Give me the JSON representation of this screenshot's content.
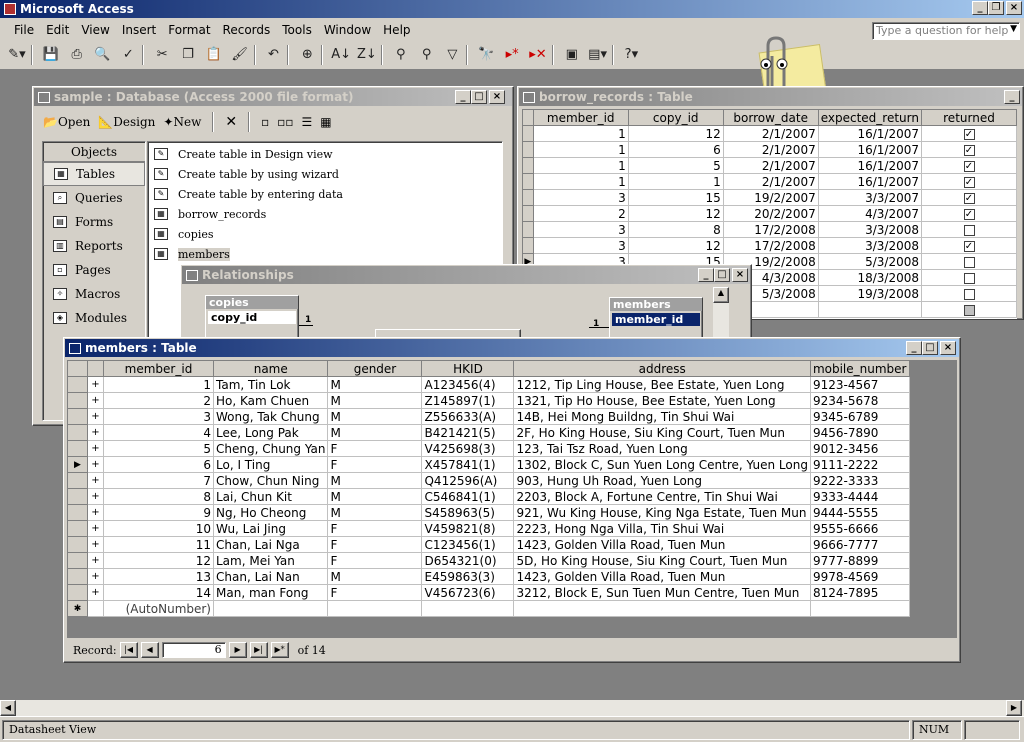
{
  "app": {
    "title": "Microsoft Access",
    "help_placeholder": "Type a question for help"
  },
  "menu": [
    "File",
    "Edit",
    "View",
    "Insert",
    "Format",
    "Records",
    "Tools",
    "Window",
    "Help"
  ],
  "db_window": {
    "title": "sample : Database (Access 2000 file format)",
    "open": "Open",
    "design": "Design",
    "new": "New",
    "objects_header": "Objects",
    "objects": [
      "Tables",
      "Queries",
      "Forms",
      "Reports",
      "Pages",
      "Macros",
      "Modules"
    ],
    "items": [
      "Create table in Design view",
      "Create table by using wizard",
      "Create table by entering data",
      "borrow_records",
      "copies",
      "members"
    ]
  },
  "borrow": {
    "title": "borrow_records : Table",
    "columns": [
      "member_id",
      "copy_id",
      "borrow_date",
      "expected_return",
      "returned"
    ],
    "rows": [
      [
        "1",
        "12",
        "2/1/2007",
        "16/1/2007",
        true
      ],
      [
        "1",
        "6",
        "2/1/2007",
        "16/1/2007",
        true
      ],
      [
        "1",
        "5",
        "2/1/2007",
        "16/1/2007",
        true
      ],
      [
        "1",
        "1",
        "2/1/2007",
        "16/1/2007",
        true
      ],
      [
        "3",
        "15",
        "19/2/2007",
        "3/3/2007",
        true
      ],
      [
        "2",
        "12",
        "20/2/2007",
        "4/3/2007",
        true
      ],
      [
        "3",
        "8",
        "17/2/2008",
        "3/3/2008",
        false
      ],
      [
        "3",
        "12",
        "17/2/2008",
        "3/3/2008",
        true
      ],
      [
        "3",
        "15",
        "19/2/2008",
        "5/3/2008",
        false
      ],
      [
        "",
        "",
        "4/3/2008",
        "18/3/2008",
        false
      ],
      [
        "",
        "",
        "5/3/2008",
        "19/3/2008",
        false
      ]
    ]
  },
  "relationships": {
    "title": "Relationships",
    "copies_title": "copies",
    "copies_field": "copy_id",
    "members_title": "members",
    "members_field": "member_id",
    "one": "1"
  },
  "members": {
    "title": "members : Table",
    "columns": [
      "member_id",
      "name",
      "gender",
      "HKID",
      "address",
      "mobile_number"
    ],
    "rows": [
      [
        "1",
        "Tam, Tin Lok",
        "M",
        "A123456(4)",
        "1212, Tip Ling House, Bee Estate, Yuen Long",
        "9123-4567"
      ],
      [
        "2",
        "Ho, Kam Chuen",
        "M",
        "Z145897(1)",
        "1321, Tip Ho House, Bee Estate, Yuen Long",
        "9234-5678"
      ],
      [
        "3",
        "Wong, Tak Chung",
        "M",
        "Z556633(A)",
        "14B, Hei Mong Buildng, Tin Shui Wai",
        "9345-6789"
      ],
      [
        "4",
        "Lee, Long Pak",
        "M",
        "B421421(5)",
        "2F, Ho King House, Siu King Court, Tuen Mun",
        "9456-7890"
      ],
      [
        "5",
        "Cheng, Chung Yan",
        "F",
        "V425698(3)",
        "123, Tai Tsz Road, Yuen Long",
        "9012-3456"
      ],
      [
        "6",
        "Lo, I Ting",
        "F",
        "X457841(1)",
        "1302, Block C, Sun Yuen Long Centre, Yuen Long",
        "9111-2222"
      ],
      [
        "7",
        "Chow, Chun Ning",
        "M",
        "Q412596(A)",
        "903, Hung Uh Road, Yuen Long",
        "9222-3333"
      ],
      [
        "8",
        "Lai, Chun Kit",
        "M",
        "C546841(1)",
        "2203, Block A, Fortune Centre, Tin Shui Wai",
        "9333-4444"
      ],
      [
        "9",
        "Ng, Ho Cheong",
        "M",
        "S458963(5)",
        "921, Wu King House, King Nga Estate, Tuen Mun",
        "9444-5555"
      ],
      [
        "10",
        "Wu, Lai Jing",
        "F",
        "V459821(8)",
        "2223, Hong Nga Villa, Tin Shui Wai",
        "9555-6666"
      ],
      [
        "11",
        "Chan, Lai Nga",
        "F",
        "C123456(1)",
        "1423, Golden Villa Road, Tuen Mun",
        "9666-7777"
      ],
      [
        "12",
        "Lam, Mei Yan",
        "F",
        "D654321(0)",
        "5D, Ho King House, Siu King Court, Tuen Mun",
        "9777-8899"
      ],
      [
        "13",
        "Chan, Lai Nan",
        "M",
        "E459863(3)",
        "1423, Golden Villa Road, Tuen Mun",
        "9978-4569"
      ],
      [
        "14",
        "Man, man Fong",
        "F",
        "V456723(6)",
        "3212, Block E, Sun Tuen Mun Centre, Tuen Mun",
        "8124-7895"
      ]
    ],
    "new_row": "(AutoNumber)",
    "current_row": 6,
    "nav_label": "Record:",
    "nav_value": "6",
    "nav_total": "of  14"
  },
  "status": {
    "left": "Datasheet View",
    "num": "NUM"
  },
  "colors": {
    "active_title": "#0a246a",
    "face": "#d4d0c8",
    "desktop": "#808080"
  }
}
